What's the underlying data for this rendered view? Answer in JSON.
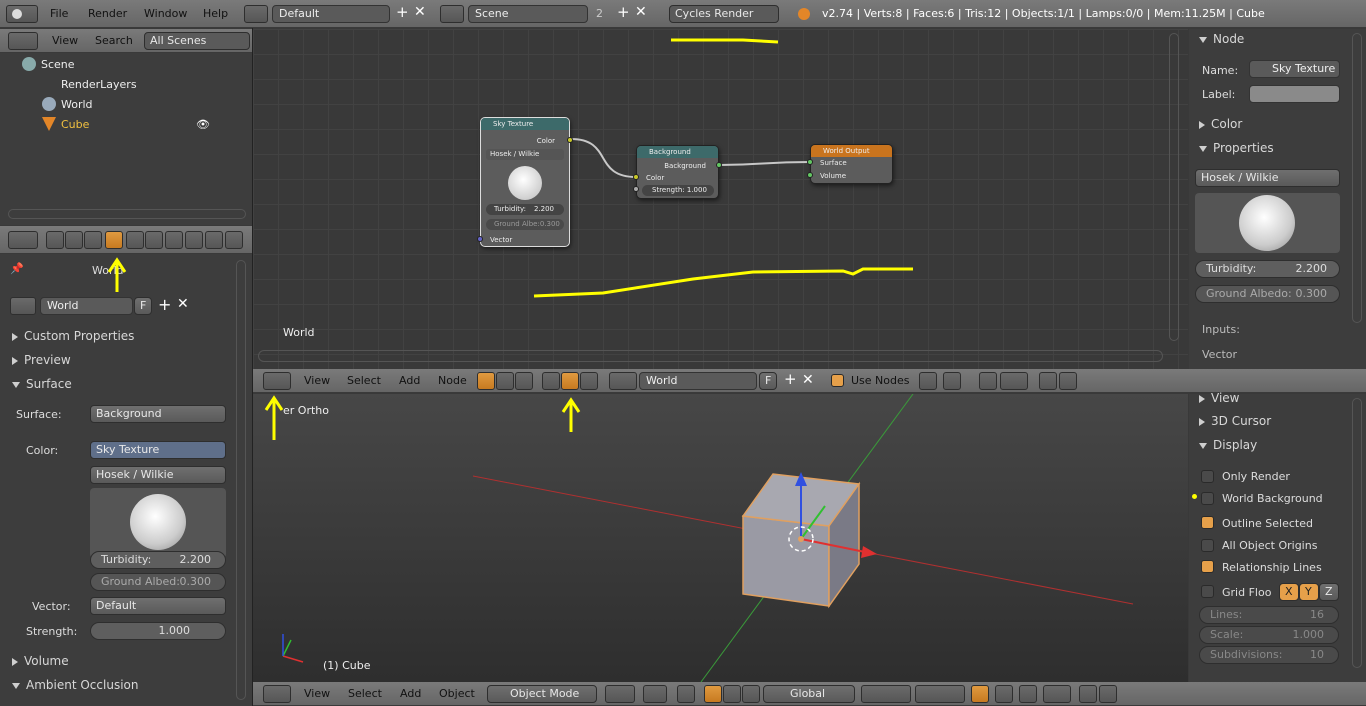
{
  "top_menu": {
    "items": [
      "File",
      "Render",
      "Window",
      "Help"
    ],
    "layout": "Default",
    "scene": "Scene",
    "scene_users": "2",
    "engine": "Cycles Render",
    "stats": "v2.74 | Verts:8 | Faces:6 | Tris:12 | Objects:1/1 | Lamps:0/0 | Mem:11.25M | Cube"
  },
  "outliner": {
    "menu": [
      "View",
      "Search"
    ],
    "filter": "All Scenes",
    "tree": {
      "scene": "Scene",
      "render_layers": "RenderLayers",
      "world": "World",
      "cube": "Cube"
    }
  },
  "properties": {
    "context_label": "World",
    "datablock": "World",
    "fake_user": "F",
    "panels": {
      "custom_props": "Custom Properties",
      "preview": "Preview",
      "surface": "Surface",
      "volume": "Volume",
      "ambient_occlusion": "Ambient Occlusion"
    },
    "surface_label": "Surface:",
    "surface_value": "Background",
    "color_label": "Color:",
    "color_value": "Sky Texture",
    "sky_model": "Hosek / Wilkie",
    "turbidity_label": "Turbidity:",
    "turbidity_value": "2.200",
    "albedo_label": "Ground Albed:",
    "albedo_value": "0.300",
    "vector_label": "Vector:",
    "vector_value": "Default",
    "strength_label": "Strength:",
    "strength_value": "1.000"
  },
  "node_editor": {
    "label": "World",
    "menu": [
      "View",
      "Select",
      "Add",
      "Node"
    ],
    "world_field": "World",
    "fake": "F",
    "use_nodes": "Use Nodes",
    "nodes": {
      "sky": {
        "title": "Sky Texture",
        "out": "Color",
        "model": "Hosek / Wilkie",
        "turb": "Turbidity:",
        "turb_v": "2.200",
        "albedo": "Ground Albe:0.300",
        "vec": "Vector"
      },
      "bg": {
        "title": "Background",
        "out": "Background",
        "color": "Color",
        "strength": "Strength: 1.000"
      },
      "wo": {
        "title": "World Output",
        "surface": "Surface",
        "volume": "Volume"
      }
    }
  },
  "node_sidebar": {
    "node_header": "Node",
    "name_label": "Name:",
    "name_value": "Sky Texture",
    "label_label": "Label:",
    "color_panel": "Color",
    "properties_panel": "Properties",
    "model": "Hosek / Wilkie",
    "turbidity_label": "Turbidity:",
    "turbidity_value": "2.200",
    "albedo_label": "Ground Albedo:",
    "albedo_value": "0.300",
    "inputs": "Inputs:",
    "vector": "Vector"
  },
  "viewport": {
    "view_label": "er Ortho",
    "object_label": "(1) Cube",
    "menu": [
      "View",
      "Select",
      "Add",
      "Object"
    ],
    "mode": "Object Mode",
    "orientation": "Global"
  },
  "viewport_sidebar": {
    "view": "View",
    "cursor": "3D Cursor",
    "display": "Display",
    "only_render": "Only Render",
    "world_bg": "World Background",
    "outline": "Outline Selected",
    "all_origins": "All Object Origins",
    "rel_lines": "Relationship Lines",
    "grid_floor": "Grid Floo",
    "x": "X",
    "y": "Y",
    "z": "Z",
    "lines_label": "Lines:",
    "lines_value": "16",
    "scale_label": "Scale:",
    "scale_value": "1.000",
    "subdiv_label": "Subdivisions:",
    "subdiv_value": "10"
  },
  "colors": {
    "accent": "#e6a04a",
    "annotation": "#ffff00",
    "node_sky": "#3d6a6a",
    "node_output": "#c9741e"
  }
}
